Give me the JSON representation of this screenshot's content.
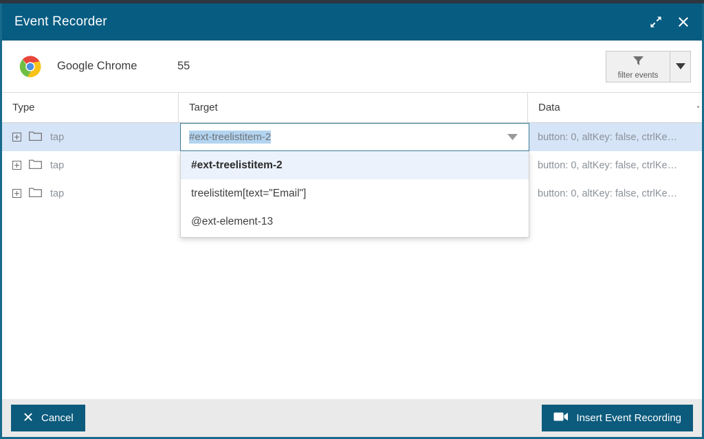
{
  "window": {
    "title": "Event Recorder",
    "expand_icon": "expand-arrows-icon",
    "close_icon": "close-icon",
    "accent_color": "#075C82",
    "border_color": "#186a8c"
  },
  "toolbar": {
    "app_icon": "google-chrome-icon",
    "app_name": "Google Chrome",
    "app_count": "55",
    "filter": {
      "icon": "funnel-icon",
      "label": "filter events",
      "arrow_icon": "caret-down-icon"
    }
  },
  "grid": {
    "columns": [
      "Type",
      "Target",
      "Data"
    ],
    "rows": [
      {
        "expand_icon": "plus-square-icon",
        "folder_icon": "folder-icon",
        "type": "tap",
        "target": "#ext-treelistitem-2",
        "data": "button: 0, altKey: false, ctrlKe…",
        "selected": true
      },
      {
        "expand_icon": "plus-square-icon",
        "folder_icon": "folder-icon",
        "type": "tap",
        "target": "",
        "data": "button: 0, altKey: false, ctrlKe…",
        "selected": false
      },
      {
        "expand_icon": "plus-square-icon",
        "folder_icon": "folder-icon",
        "type": "tap",
        "target": "",
        "data": "button: 0, altKey: false, ctrlKe…",
        "selected": false
      }
    ]
  },
  "editor": {
    "value": "#ext-treelistitem-2",
    "selected_text": "#ext-treelistitem-2",
    "trigger_icon": "caret-down-icon",
    "selection_color": "#B3D4F0"
  },
  "dropdown": {
    "options": [
      {
        "label": "#ext-treelistitem-2",
        "active": true
      },
      {
        "label": "treelistitem[text=\"Email\"]",
        "active": false
      },
      {
        "label": "@ext-element-13",
        "active": false
      }
    ]
  },
  "footer": {
    "cancel": {
      "icon": "close-x-icon",
      "label": "Cancel"
    },
    "insert": {
      "icon": "video-camera-icon",
      "label": "Insert Event Recording"
    }
  }
}
